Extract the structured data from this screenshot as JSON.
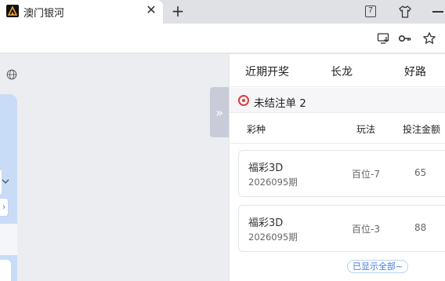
{
  "browser": {
    "tab_title": "澳门银河",
    "tab_close": "✕",
    "new_tab": "+",
    "tab_count": "7"
  },
  "panel": {
    "tabs": [
      "近期开奖",
      "长龙",
      "好路"
    ],
    "section_title": "未结注单 2",
    "columns": {
      "type": "彩种",
      "play": "玩法",
      "amount": "投注金额"
    },
    "bets": [
      {
        "name": "福彩3D",
        "issue": "2026095期",
        "play": "百位-7",
        "amount": "65"
      },
      {
        "name": "福彩3D",
        "issue": "2026095期",
        "play": "百位-3",
        "amount": "88"
      }
    ],
    "show_all": "已显示全部~"
  },
  "colors": {
    "accent": "#3d7be0",
    "record": "#e03c3c",
    "side_panel": "#c9dcf7"
  }
}
